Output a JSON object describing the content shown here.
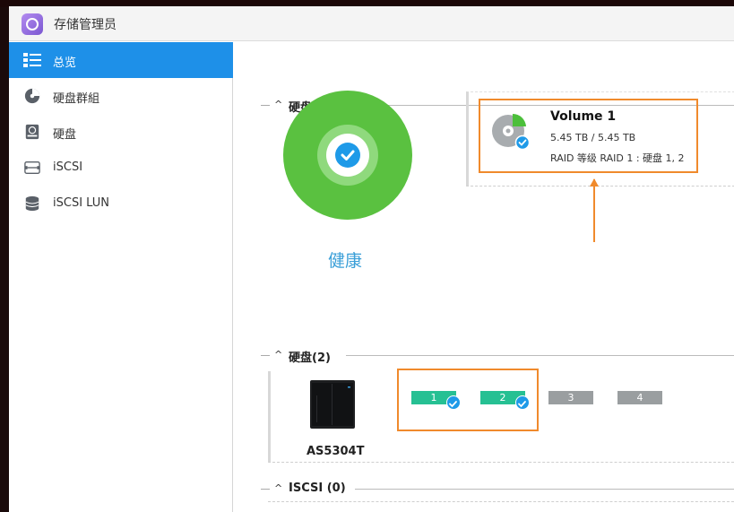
{
  "app": {
    "title": "存储管理员"
  },
  "sidebar": {
    "items": [
      {
        "label": "总览",
        "icon": "overview-list-icon",
        "active": true
      },
      {
        "label": "硬盘群組",
        "icon": "volume-pie-icon",
        "active": false
      },
      {
        "label": "硬盘",
        "icon": "hard-disk-icon",
        "active": false
      },
      {
        "label": "iSCSI",
        "icon": "iscsi-target-icon",
        "active": false
      },
      {
        "label": "iSCSI LUN",
        "icon": "iscsi-lun-database-icon",
        "active": false
      }
    ]
  },
  "main": {
    "volume_group": {
      "header": "硬盘群組 (1)",
      "health": "健康",
      "volumes": [
        {
          "name": "Volume 1",
          "size": "5.45 TB / 5.45 TB",
          "raid": "RAID 等级 RAID 1 : 硬盘 1, 2"
        }
      ]
    },
    "disks": {
      "header": "硬盘(2)",
      "nas_model": "AS5304T",
      "bays": [
        {
          "label": "1",
          "state": "ok"
        },
        {
          "label": "2",
          "state": "ok"
        },
        {
          "label": "3",
          "state": "empty"
        },
        {
          "label": "4",
          "state": "empty"
        }
      ]
    },
    "iscsi": {
      "header": "ISCSI (0)"
    }
  },
  "colors": {
    "accent": "#1e90e8",
    "healthy_green": "#5ac140",
    "disk_ok": "#26c093",
    "disk_empty": "#9a9ea0",
    "highlight_orange": "#f08a2c"
  }
}
